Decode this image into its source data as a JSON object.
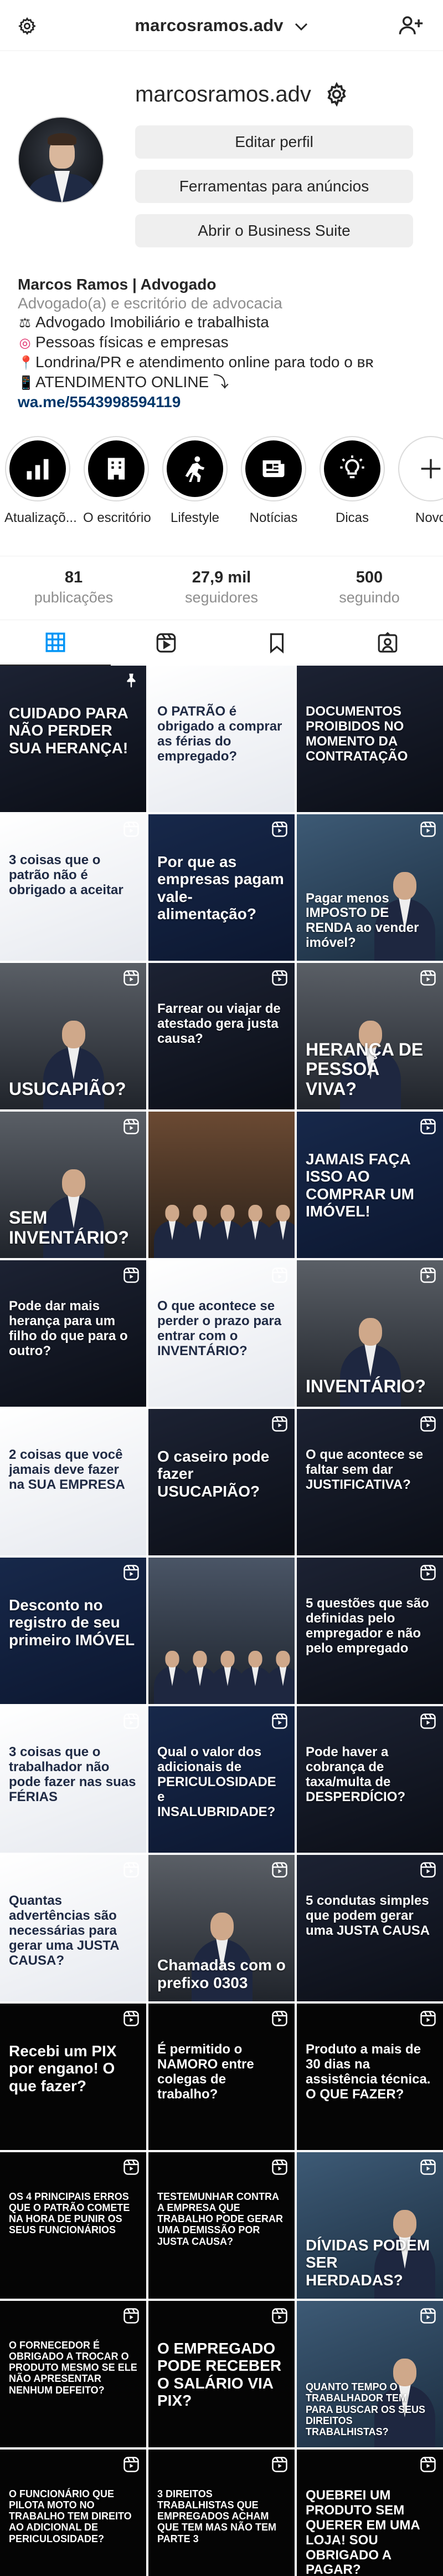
{
  "header": {
    "username": "marcosramos.adv"
  },
  "profile": {
    "username": "marcosramos.adv",
    "buttons": {
      "edit": "Editar perfil",
      "ads": "Ferramentas para anúncios",
      "business": "Abrir o Business Suite"
    }
  },
  "bio": {
    "name": "Marcos Ramos | Advogado",
    "category": "Advogado(a) e escritório de advocacia",
    "lines": [
      {
        "emoji": "⚖",
        "text": "Advogado Imobiliário e trabalhista"
      },
      {
        "emoji": "◎",
        "text": "Pessoas físicas e empresas"
      },
      {
        "emoji": "📍",
        "text": "Londrina/PR e atendimento online para todo o ʙʀ"
      },
      {
        "emoji": "📱",
        "text": "ATENDIMENTO ONLINE ⤵"
      }
    ],
    "link": "wa.me/5543998594119"
  },
  "highlights": [
    {
      "label": "Atualizaçõ...",
      "icon": "chart-icon"
    },
    {
      "label": "O escritório",
      "icon": "building-icon"
    },
    {
      "label": "Lifestyle",
      "icon": "runner-icon"
    },
    {
      "label": "Notícias",
      "icon": "newspaper-icon"
    },
    {
      "label": "Dicas",
      "icon": "lightbulb-icon"
    },
    {
      "label": "Novo",
      "icon": "plus-icon"
    }
  ],
  "stats": [
    {
      "value": "81",
      "label": "publicações"
    },
    {
      "value": "27,9 mil",
      "label": "seguidores"
    },
    {
      "value": "500",
      "label": "seguindo"
    }
  ],
  "posts": [
    {
      "text": "CUIDADO PARA NÃO PERDER SUA HERANÇA!",
      "theme": "dark",
      "badge": "pin-icon"
    },
    {
      "text": "O PATRÃO é obrigado a comprar as férias do empregado?",
      "theme": "light",
      "badge": ""
    },
    {
      "text": "DOCUMENTOS PROIBIDOS NO MOMENTO DA CONTRATAÇÃO",
      "theme": "dark",
      "badge": ""
    },
    {
      "text": "3 coisas que o patrão não é obrigado a aceitar",
      "theme": "light",
      "badge": "reel-icon"
    },
    {
      "text": "Por que as empresas pagam vale-alimentação?",
      "theme": "navy",
      "badge": "reel-icon"
    },
    {
      "text": "Pagar menos IMPOSTO DE RENDA ao vender imóvel?",
      "theme": "steel",
      "badge": "reel-icon"
    },
    {
      "text": "USUCAPIÃO?",
      "theme": "photo",
      "badge": "reel-icon"
    },
    {
      "text": "Farrear ou viajar de atestado gera justa causa?",
      "theme": "dark",
      "badge": "reel-icon"
    },
    {
      "text": "HERANÇA DE PESSOA VIVA?",
      "theme": "photo",
      "badge": "reel-icon"
    },
    {
      "text": "SEM INVENTÁRIO?",
      "theme": "photo",
      "badge": "reel-icon"
    },
    {
      "text": "",
      "theme": "event",
      "badge": ""
    },
    {
      "text": "JAMAIS FAÇA ISSO AO COMPRAR UM IMÓVEL!",
      "theme": "navy",
      "badge": "reel-icon"
    },
    {
      "text": "Pode dar mais herança para um filho do que para o outro?",
      "theme": "dark",
      "badge": "reel-icon"
    },
    {
      "text": "O que acontece se perder o prazo para entrar com o INVENTÁRIO?",
      "theme": "light",
      "badge": "reel-icon"
    },
    {
      "text": "INVENTÁRIO?",
      "theme": "photo",
      "badge": "reel-icon"
    },
    {
      "text": "2 coisas que você jamais deve fazer na SUA EMPRESA",
      "theme": "light",
      "badge": ""
    },
    {
      "text": "O caseiro pode fazer USUCAPIÃO?",
      "theme": "dark",
      "badge": "reel-icon"
    },
    {
      "text": "O que acontece se faltar sem dar JUSTIFICATIVA?",
      "theme": "dark",
      "badge": "reel-icon"
    },
    {
      "text": "Desconto no registro de seu primeiro IMÓVEL",
      "theme": "navy",
      "badge": "reel-icon"
    },
    {
      "text": "",
      "theme": "event2",
      "badge": ""
    },
    {
      "text": "5 questões que são definidas pelo empregador e não pelo empregado",
      "theme": "dark",
      "badge": "reel-icon"
    },
    {
      "text": "3 coisas que o trabalhador não pode fazer nas suas FÉRIAS",
      "theme": "light",
      "badge": "reel-icon"
    },
    {
      "text": "Qual o valor dos adicionais de PERICULOSIDADE e INSALUBRIDADE?",
      "theme": "navy",
      "badge": "reel-icon"
    },
    {
      "text": "Pode haver a cobrança de taxa/multa de DESPERDÍCIO?",
      "theme": "dark",
      "badge": "reel-icon"
    },
    {
      "text": "Quantas advertências são necessárias para gerar uma JUSTA CAUSA?",
      "theme": "light",
      "badge": "reel-icon"
    },
    {
      "text": "Chamadas com o prefixo 0303",
      "theme": "photo",
      "badge": "reel-icon"
    },
    {
      "text": "5 condutas simples que podem gerar uma JUSTA CAUSA",
      "theme": "dark",
      "badge": "reel-icon"
    },
    {
      "text": "Recebi um PIX por engano! O que fazer?",
      "theme": "black",
      "badge": "reel-icon"
    },
    {
      "text": "É permitido o NAMORO entre colegas de trabalho?",
      "theme": "black",
      "badge": "reel-icon"
    },
    {
      "text": "Produto a mais de 30 dias na assistência técnica. O QUE FAZER?",
      "theme": "black",
      "badge": "reel-icon"
    },
    {
      "text": "OS 4 PRINCIPAIS ERROS QUE O PATRÃO COMETE NA HORA DE PUNIR OS SEUS FUNCIONÁRIOS",
      "theme": "black",
      "badge": "reel-icon"
    },
    {
      "text": "TESTEMUNHAR CONTRA A EMPRESA QUE TRABALHO PODE GERAR UMA DEMISSÃO POR JUSTA CAUSA?",
      "theme": "black",
      "badge": "reel-icon"
    },
    {
      "text": "DÍVIDAS PODEM SER HERDADAS?",
      "theme": "steel",
      "badge": "reel-icon"
    },
    {
      "text": "O FORNECEDOR É OBRIGADO A TROCAR O PRODUTO MESMO SE ELE NÃO APRESENTAR NENHUM DEFEITO?",
      "theme": "black",
      "badge": "reel-icon"
    },
    {
      "text": "O EMPREGADO PODE RECEBER O SALÁRIO VIA PIX?",
      "theme": "black",
      "badge": "reel-icon"
    },
    {
      "text": "QUANTO TEMPO O TRABALHADOR TEM PARA BUSCAR OS SEUS DIREITOS TRABALHISTAS?",
      "theme": "steel",
      "badge": "reel-icon"
    },
    {
      "text": "O FUNCIONÁRIO QUE PILOTA MOTO NO TRABALHO TEM DIREITO AO ADICIONAL DE PERICULOSIDADE?",
      "theme": "black",
      "badge": "reel-icon"
    },
    {
      "text": "3 DIREITOS TRABALHISTAS QUE EMPREGADOS ACHAM QUE TEM MAS NÃO TEM PARTE 3",
      "theme": "black",
      "badge": "reel-icon"
    },
    {
      "text": "QUEBREI UM PRODUTO SEM QUERER EM UMA LOJA! SOU OBRIGADO A PAGAR?",
      "theme": "black",
      "badge": "reel-icon"
    }
  ]
}
